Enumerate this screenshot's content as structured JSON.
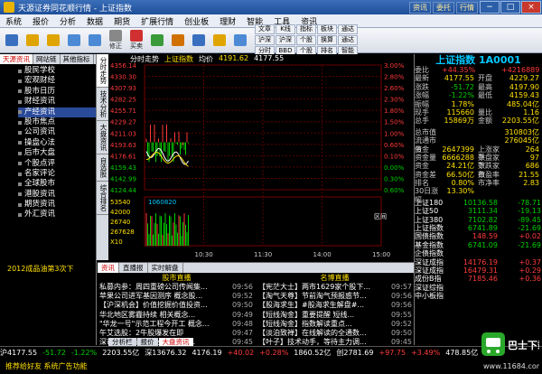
{
  "window": {
    "title": "天源证券同花顺行情 - 上证指数",
    "links": [
      "资讯",
      "委托",
      "行情"
    ]
  },
  "menu": [
    "系统",
    "报价",
    "分析",
    "数据",
    "期货",
    "扩展行情",
    "创业板",
    "理财",
    "智能",
    "工具",
    "资讯"
  ],
  "toolbar": {
    "tools": [
      "",
      "",
      "",
      "",
      "",
      "修正",
      "买卖",
      "",
      "",
      "",
      "",
      ""
    ],
    "grid": [
      "文章",
      "K线",
      "指标",
      "板块",
      "通达",
      "沪深",
      "沪深",
      "个股",
      "换算",
      "通达",
      "分时",
      "BBD",
      "个股",
      "排名",
      "智能"
    ]
  },
  "left_panel": {
    "tabs": [
      "天源资讯",
      "网站链",
      "其他指标"
    ],
    "items": [
      "股民学校",
      "宏观财经",
      "股市日历",
      "财经资讯",
      "产经资讯",
      "股市焦点",
      "公司资讯",
      "操盘心法",
      "后市大盘",
      "个股点评",
      "名家评论",
      "全球股市",
      "港股资讯",
      "期货资讯",
      "外汇资讯"
    ],
    "selected_index": 4,
    "news": "2012成品油第3次下"
  },
  "side_tabs": [
    "分时走势",
    "技术分析",
    "大盘资讯",
    "自选股",
    "综合排名"
  ],
  "chart": {
    "header_label": "分时走势",
    "name": "上证指数",
    "note": "均价",
    "price_label": "4191.62",
    "avg_label": "4177.55",
    "left_axis": [
      "4356.14",
      "4330.30",
      "4307.93",
      "4282.25",
      "4255.71",
      "4229.27",
      "4211.03",
      "4193.63",
      "4176.61",
      "4159.43",
      "4142.99",
      "4124.44"
    ],
    "right_axis": [
      "3.00%",
      "2.80%",
      "2.60%",
      "2.30%",
      "1.80%",
      "1.50%",
      "1.00%",
      "0.60%",
      "0.10%",
      "0.00%",
      "0.30%",
      "0.60%"
    ],
    "volume_axis": [
      "53540",
      "42000",
      "26740",
      "267628",
      "X10"
    ],
    "volume_label": "1060820",
    "time_ticks": [
      "10:30",
      "11:30",
      "14:00",
      "15:00"
    ],
    "zoom_label": "区间"
  },
  "right_panel": {
    "title": "上证指数 1A0001",
    "rows1": [
      [
        "委比",
        "+44.35%",
        "",
        "+4216889"
      ],
      [
        "最新",
        "4177.55",
        "开盘",
        "4229.27"
      ],
      [
        "涨跌",
        "-51.72",
        "最高",
        "4197.90"
      ],
      [
        "涨幅",
        "-1.22%",
        "最低",
        "4159.43"
      ],
      [
        "振幅",
        "1.78%",
        "",
        "485.04亿"
      ],
      [
        "现手",
        "115660",
        "量比",
        "1.16"
      ],
      [
        "总手",
        "15869万",
        "金额",
        "2203.55亿"
      ]
    ],
    "rows2": [
      [
        "总市值",
        "",
        "",
        "310803亿"
      ],
      [
        "流通市值",
        "",
        "",
        "276045亿"
      ],
      [
        "资金",
        "2647399",
        "上涨家数",
        "264"
      ],
      [
        "资金量",
        "6666288",
        "平盘家数",
        "97"
      ],
      [
        "资金",
        "24.21亿",
        "下跌家数",
        "686"
      ],
      [
        "资金差",
        "66.50亿",
        "市盈率",
        "21.55"
      ],
      [
        "排名",
        "0.80%",
        "市净率",
        "2.83"
      ],
      [
        "30日涨幅",
        "13.30%",
        "",
        ""
      ]
    ],
    "indexes": [
      [
        "上证180",
        "10136.58",
        "-78.71"
      ],
      [
        "上证50",
        "3111.34",
        "-19.13"
      ],
      [
        "上证380",
        "7102.82",
        "-89.45"
      ],
      [
        "上证指数",
        "6741.89",
        "-21.69"
      ],
      [
        "国债指数",
        "148.59",
        "+0.02"
      ],
      [
        "基金指数",
        "6741.09",
        "-21.69"
      ],
      [
        "企债指数",
        "",
        ""
      ],
      [
        "深证成指",
        "14176.19",
        "+0.37"
      ],
      [
        "深证成指",
        "16479.31",
        "+0.29"
      ],
      [
        "成份B指",
        "7185.46",
        "+0.36"
      ],
      [
        "深证综指",
        "",
        ""
      ],
      [
        "中小板指",
        "",
        ""
      ]
    ]
  },
  "news": {
    "tabs": [
      "资讯",
      "直播报",
      "实时解盘"
    ],
    "left_head": "股市直播",
    "right_head": "名博直播",
    "left_items": [
      [
        "私募内参：周四重磅公司传闻集...",
        "09:56"
      ],
      [
        "苹果公司进军基因测序 概念股...",
        "09:52"
      ],
      [
        "【沪深机会】价值挖掘价值投资...",
        "09:50"
      ],
      [
        "华北地区雾霾持续 相关概念...",
        "09:49"
      ],
      [
        "\"华龙一号\"示范工程今开工 概念...",
        "09:48"
      ],
      [
        "午艾选股：2牛股爆发在即",
        "09:47"
      ],
      [
        "深市两市 消费升级中的机会...",
        "09:45"
      ]
    ],
    "right_items": [
      [
        "【宪茫大士】两市1629家个股下...",
        "09:57"
      ],
      [
        "【淘气天尊】节前淘气预报惑节...",
        "09:56"
      ],
      [
        "【股海求生】#股海求生解盘#...",
        "09:56"
      ],
      [
        "【短线淘金】重要提醒 短线...",
        "09:55"
      ],
      [
        "【短线淘金】指数解读重点...",
        "09:52"
      ],
      [
        "【淡泊致禅】在线解读的全通数...",
        "09:50"
      ],
      [
        "【叶子】技术动手，等待主力调...",
        "09:45"
      ]
    ]
  },
  "bottom_tabs": [
    "分析栏",
    "报价",
    "大盘资讯"
  ],
  "status": {
    "items": [
      "沪4177.55",
      "-51.72",
      "-1.22%",
      "2203.55亿",
      "深13676.32",
      "4176.19",
      "+40.02",
      "+0.28%",
      "1860.52亿",
      "创2781.69",
      "+97.75",
      "+3.49%",
      "478.85亿"
    ]
  },
  "footer": {
    "text": "推荐给好友 系统广告功能",
    "logo_text": "巴士下载",
    "logo_url": "www.11684.com"
  }
}
